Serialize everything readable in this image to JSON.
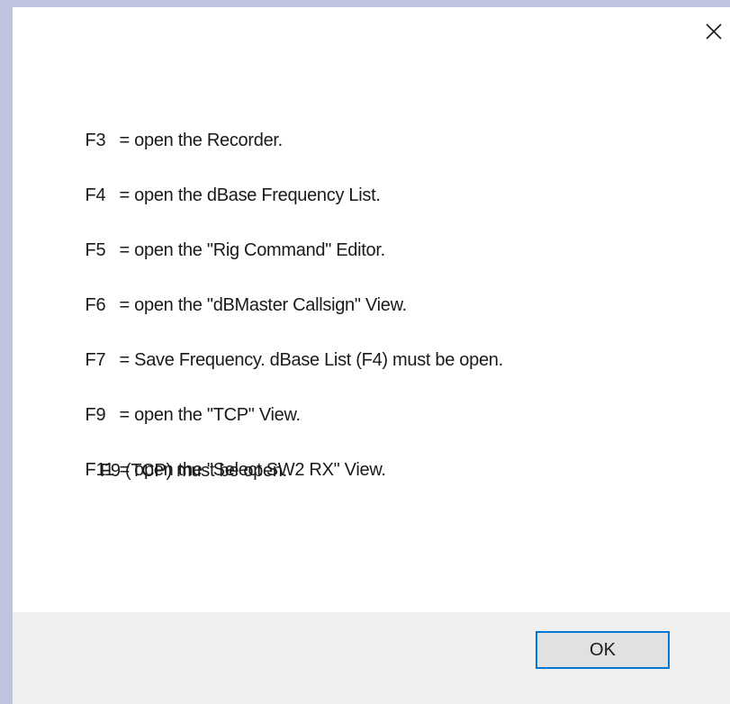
{
  "dialog": {
    "close_icon": "close-icon",
    "lines": [
      {
        "key": "F3",
        "text": "= open the Recorder."
      },
      {
        "key": "F4",
        "text": "= open the dBase Frequency List."
      },
      {
        "key": "F5",
        "text": "= open the \"Rig Command\" Editor."
      },
      {
        "key": "F6",
        "text": "= open the \"dBMaster Callsign\" View."
      },
      {
        "key": "F7",
        "text": "= Save Frequency. dBase List (F4) must be open."
      },
      {
        "key": "F9",
        "text": "= open the \"TCP\" View."
      },
      {
        "key": "F11",
        "text": "= open the \"Select SW2 RX\" View."
      }
    ],
    "continuation": "F9 (TCP) must be open.",
    "ok_label": "OK"
  }
}
